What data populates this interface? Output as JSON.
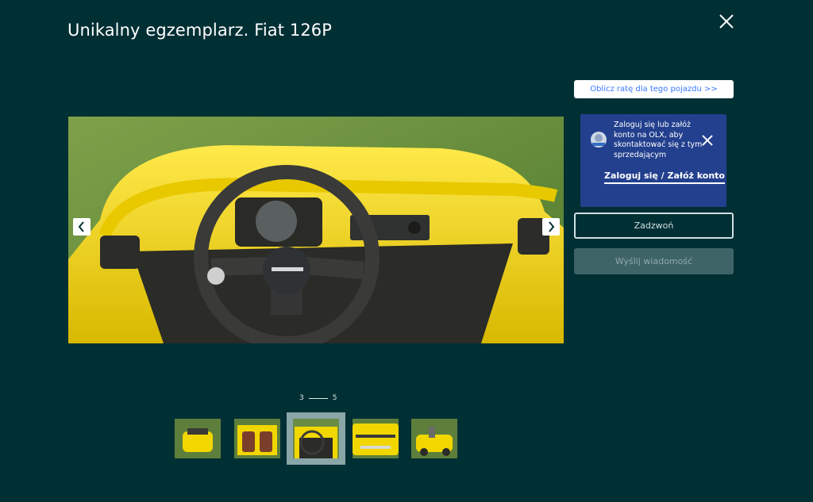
{
  "title": "Unikalny egzemplarz. Fiat 126P",
  "rate_button_label": "Oblicz ratę dla tego pojazdu >>",
  "login_box": {
    "message": "Zaloguj się lub załóż konto na OLX, aby skontaktować się z tym sprzedającym",
    "link_label": "Zaloguj się / Załóż konto"
  },
  "call_button_label": "Zadzwoń",
  "message_button_label": "Wyślij wiadomość",
  "gallery": {
    "current": "3",
    "total": "5",
    "thumbnails": [
      {
        "icon": "car-rear-thumbnail"
      },
      {
        "icon": "car-seats-thumbnail"
      },
      {
        "icon": "steering-wheel-thumbnail"
      },
      {
        "icon": "car-side-thumbnail"
      },
      {
        "icon": "car-front-thumbnail"
      }
    ]
  },
  "colors": {
    "background": "#002f34",
    "login_box": "#23408e",
    "accent_link": "#3a77ff",
    "car_yellow": "#f2d600"
  }
}
